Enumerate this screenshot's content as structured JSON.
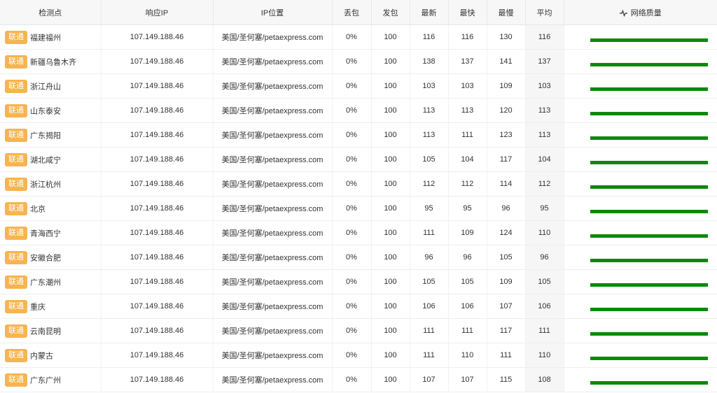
{
  "headers": {
    "location": "检测点",
    "ip": "响应IP",
    "ip_loc": "IP位置",
    "loss": "丢包",
    "sent": "发包",
    "latest": "最新",
    "fastest": "最快",
    "slowest": "最慢",
    "avg": "平均",
    "quality": "网络质量"
  },
  "rows": [
    {
      "isp": "联通",
      "location": "福建福州",
      "ip": "107.149.188.46",
      "ip_loc": "美国/圣何塞/petaexpress.com",
      "loss": "0%",
      "sent": "100",
      "latest": "116",
      "fastest": "116",
      "slowest": "130",
      "avg": "116"
    },
    {
      "isp": "联通",
      "location": "新疆乌鲁木齐",
      "ip": "107.149.188.46",
      "ip_loc": "美国/圣何塞/petaexpress.com",
      "loss": "0%",
      "sent": "100",
      "latest": "138",
      "fastest": "137",
      "slowest": "141",
      "avg": "137"
    },
    {
      "isp": "联通",
      "location": "浙江舟山",
      "ip": "107.149.188.46",
      "ip_loc": "美国/圣何塞/petaexpress.com",
      "loss": "0%",
      "sent": "100",
      "latest": "103",
      "fastest": "103",
      "slowest": "109",
      "avg": "103"
    },
    {
      "isp": "联通",
      "location": "山东泰安",
      "ip": "107.149.188.46",
      "ip_loc": "美国/圣何塞/petaexpress.com",
      "loss": "0%",
      "sent": "100",
      "latest": "113",
      "fastest": "113",
      "slowest": "120",
      "avg": "113"
    },
    {
      "isp": "联通",
      "location": "广东揭阳",
      "ip": "107.149.188.46",
      "ip_loc": "美国/圣何塞/petaexpress.com",
      "loss": "0%",
      "sent": "100",
      "latest": "113",
      "fastest": "111",
      "slowest": "123",
      "avg": "113"
    },
    {
      "isp": "联通",
      "location": "湖北咸宁",
      "ip": "107.149.188.46",
      "ip_loc": "美国/圣何塞/petaexpress.com",
      "loss": "0%",
      "sent": "100",
      "latest": "105",
      "fastest": "104",
      "slowest": "117",
      "avg": "104"
    },
    {
      "isp": "联通",
      "location": "浙江杭州",
      "ip": "107.149.188.46",
      "ip_loc": "美国/圣何塞/petaexpress.com",
      "loss": "0%",
      "sent": "100",
      "latest": "112",
      "fastest": "112",
      "slowest": "114",
      "avg": "112"
    },
    {
      "isp": "联通",
      "location": "北京",
      "ip": "107.149.188.46",
      "ip_loc": "美国/圣何塞/petaexpress.com",
      "loss": "0%",
      "sent": "100",
      "latest": "95",
      "fastest": "95",
      "slowest": "96",
      "avg": "95"
    },
    {
      "isp": "联通",
      "location": "青海西宁",
      "ip": "107.149.188.46",
      "ip_loc": "美国/圣何塞/petaexpress.com",
      "loss": "0%",
      "sent": "100",
      "latest": "111",
      "fastest": "109",
      "slowest": "124",
      "avg": "110"
    },
    {
      "isp": "联通",
      "location": "安徽合肥",
      "ip": "107.149.188.46",
      "ip_loc": "美国/圣何塞/petaexpress.com",
      "loss": "0%",
      "sent": "100",
      "latest": "96",
      "fastest": "96",
      "slowest": "105",
      "avg": "96"
    },
    {
      "isp": "联通",
      "location": "广东潮州",
      "ip": "107.149.188.46",
      "ip_loc": "美国/圣何塞/petaexpress.com",
      "loss": "0%",
      "sent": "100",
      "latest": "105",
      "fastest": "105",
      "slowest": "109",
      "avg": "105"
    },
    {
      "isp": "联通",
      "location": "重庆",
      "ip": "107.149.188.46",
      "ip_loc": "美国/圣何塞/petaexpress.com",
      "loss": "0%",
      "sent": "100",
      "latest": "106",
      "fastest": "106",
      "slowest": "107",
      "avg": "106"
    },
    {
      "isp": "联通",
      "location": "云南昆明",
      "ip": "107.149.188.46",
      "ip_loc": "美国/圣何塞/petaexpress.com",
      "loss": "0%",
      "sent": "100",
      "latest": "111",
      "fastest": "111",
      "slowest": "117",
      "avg": "111"
    },
    {
      "isp": "联通",
      "location": "内蒙古",
      "ip": "107.149.188.46",
      "ip_loc": "美国/圣何塞/petaexpress.com",
      "loss": "0%",
      "sent": "100",
      "latest": "111",
      "fastest": "110",
      "slowest": "111",
      "avg": "110"
    },
    {
      "isp": "联通",
      "location": "广东广州",
      "ip": "107.149.188.46",
      "ip_loc": "美国/圣何塞/petaexpress.com",
      "loss": "0%",
      "sent": "100",
      "latest": "107",
      "fastest": "107",
      "slowest": "115",
      "avg": "108"
    }
  ],
  "icons": {
    "quality": "pulse-icon"
  },
  "colors": {
    "isp_badge": "#f7b44f",
    "quality_bar": "#0a8a0a",
    "header_bg": "#f7f7f7"
  }
}
